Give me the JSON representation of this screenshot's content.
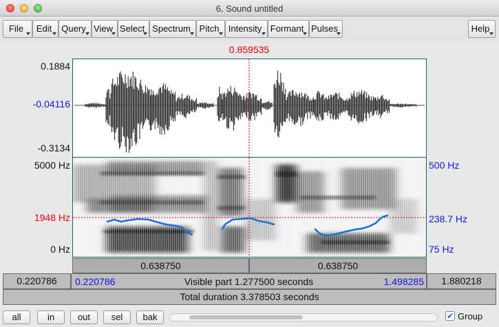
{
  "window": {
    "title": "6. Sound untitled"
  },
  "menus": [
    {
      "label": "File"
    },
    {
      "label": "Edit"
    },
    {
      "label": "Query"
    },
    {
      "label": "View"
    },
    {
      "label": "Select"
    },
    {
      "label": "Spectrum"
    },
    {
      "label": "Pitch"
    },
    {
      "label": "Intensity"
    },
    {
      "label": "Formant"
    },
    {
      "label": "Pulses"
    }
  ],
  "help": {
    "label": "Help"
  },
  "cursor": {
    "time": "0.859535",
    "color": "#e00000"
  },
  "waveform": {
    "max": "0.1884",
    "cursor_value": "-0.04116",
    "min": "-0.3134"
  },
  "spectrogram": {
    "freq_top": "5000 Hz",
    "freq_cursor": "1948 Hz",
    "freq_bottom": "0 Hz",
    "pitch_top": "500 Hz",
    "pitch_cursor": "238.7 Hz",
    "pitch_bottom": "75 Hz",
    "pitch_color": "#1a6fd8"
  },
  "selection": {
    "left_duration": "0.638750",
    "right_duration": "0.638750"
  },
  "visible": {
    "window_start": "0.220786",
    "start": "0.220786",
    "label": "Visible part 1.277500 seconds",
    "end": "1.498285",
    "window_end": "1.880218"
  },
  "total": {
    "label": "Total duration 3.378503 seconds"
  },
  "zoom_buttons": [
    {
      "label": "all"
    },
    {
      "label": "in"
    },
    {
      "label": "out"
    },
    {
      "label": "sel"
    },
    {
      "label": "bak"
    }
  ],
  "group": {
    "label": "Group",
    "checked": true,
    "mark": "✔"
  }
}
